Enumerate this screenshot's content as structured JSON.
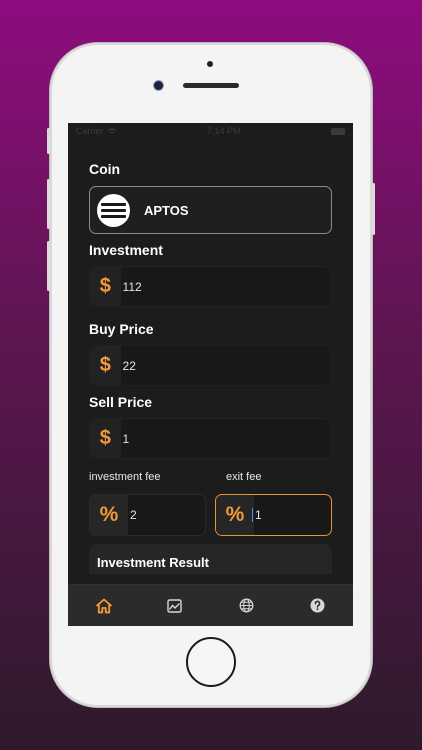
{
  "colors": {
    "accent": "#f29a3c",
    "screen_bg": "#1c1c1c",
    "input_bg": "#181818",
    "tab_active": "#f29a3c",
    "tab_inactive": "#d8d8d8"
  },
  "status_bar": {
    "carrier": "Carrier",
    "time": "7:14 PM"
  },
  "form": {
    "coin_label": "Coin",
    "coin_name": "APTOS",
    "coin_icon": "aptos-logo-icon",
    "investment_label": "Investment",
    "investment_value": "112",
    "buy_price_label": "Buy Price",
    "buy_price_value": "22",
    "sell_price_label": "Sell Price",
    "sell_price_value": "1",
    "currency_symbol": "$",
    "investment_fee_label": "investment fee",
    "exit_fee_label": "exit fee",
    "percent_symbol": "%",
    "investment_fee_value": "2",
    "exit_fee_value": "1",
    "result_title": "Investment Result"
  },
  "tabs": [
    {
      "icon": "home-icon",
      "active": true
    },
    {
      "icon": "chart-icon",
      "active": false
    },
    {
      "icon": "globe-icon",
      "active": false
    },
    {
      "icon": "help-icon",
      "active": false
    }
  ]
}
